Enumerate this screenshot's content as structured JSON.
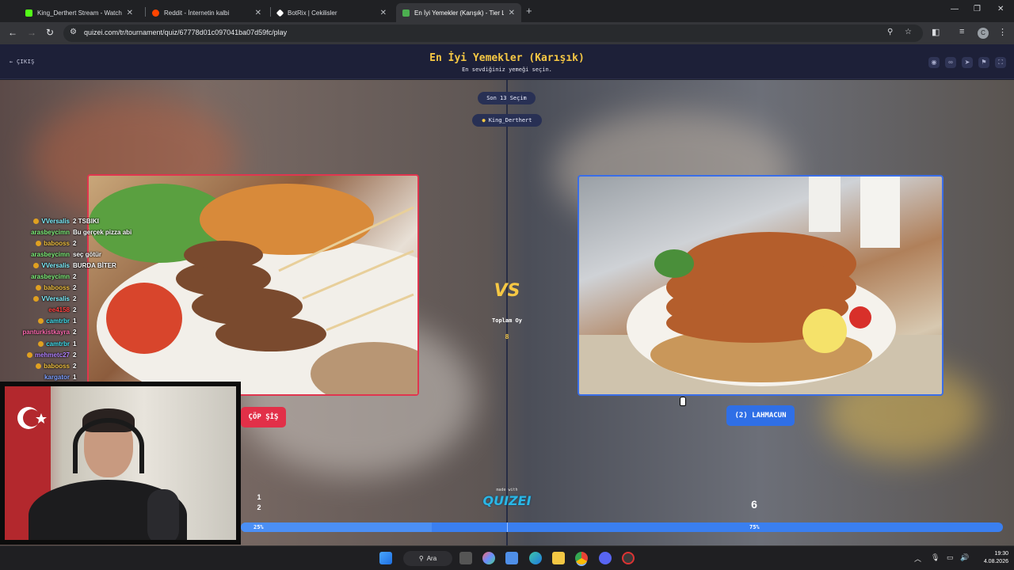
{
  "browser": {
    "tabs": [
      {
        "title": "King_Derthert Stream - Watch L",
        "favicon_color": "#53fc18"
      },
      {
        "title": "Reddit - İnternetin kalbi",
        "favicon_color": "#ff4500"
      },
      {
        "title": "BotRix | Cekilisler",
        "favicon_color": "#ffffff"
      },
      {
        "title": "En İyi Yemekler (Karışık) - Tier L",
        "favicon_color": "#4caf50"
      }
    ],
    "url": "quizei.com/tr/tournament/quiz/67778d01c097041ba07d59fc/play",
    "profile_initial": "C"
  },
  "app": {
    "exit_label": "ÇIKIŞ",
    "title": "En İyi Yemekler (Karışık)",
    "subtitle": "En sevdiğiniz yemeği seçin.",
    "round_label": "Son 13 Seçim",
    "streamer": "King_Derthert"
  },
  "choices": {
    "left": {
      "label": "ÇÖP ŞİŞ",
      "count": "1\n2",
      "percent": "25%"
    },
    "right": {
      "label": "(2) LAHMACUN",
      "count": "6",
      "percent": "75%"
    }
  },
  "center": {
    "vs": "VS",
    "total_label": "Toplam Oy",
    "total_value": "8",
    "made_with": "made with",
    "logo": "QUIZEI"
  },
  "progress": {
    "left_fraction": 0.25,
    "right_fraction": 0.75
  },
  "chat": [
    {
      "name": "VVersalis",
      "msg": "2 TSBIKI",
      "color": "#7ef0ff",
      "badge": true
    },
    {
      "name": "arasbeycimn",
      "msg": "Bu gerçek pizza abi",
      "color": "#7ef07a",
      "badge": false
    },
    {
      "name": "babooss",
      "msg": "2",
      "color": "#f0c040",
      "badge": true
    },
    {
      "name": "arasbeycimn",
      "msg": "seç götür",
      "color": "#7ef07a",
      "badge": false
    },
    {
      "name": "VVersalis",
      "msg": "BURDA BİTER",
      "color": "#7ef0ff",
      "badge": true
    },
    {
      "name": "arasbeycimn",
      "msg": "2",
      "color": "#7ef07a",
      "badge": false
    },
    {
      "name": "babooss",
      "msg": "2",
      "color": "#f0c040",
      "badge": true
    },
    {
      "name": "VVersalis",
      "msg": "2",
      "color": "#7ef0ff",
      "badge": true
    },
    {
      "name": "ee4158",
      "msg": "2",
      "color": "#ff4040",
      "badge": false
    },
    {
      "name": "camtrbr",
      "msg": "1",
      "color": "#40e0f0",
      "badge": true
    },
    {
      "name": "panturkistkayra",
      "msg": "2",
      "color": "#ff6ab0",
      "badge": false
    },
    {
      "name": "camtrbr",
      "msg": "1",
      "color": "#40e0f0",
      "badge": true
    },
    {
      "name": "mehmetc27",
      "msg": "2",
      "color": "#b080ff",
      "badge": true
    },
    {
      "name": "babooss",
      "msg": "2",
      "color": "#f0c040",
      "badge": true
    },
    {
      "name": "kargator",
      "msg": "1",
      "color": "#7ea0ff",
      "badge": false
    }
  ],
  "taskbar": {
    "search_label": "Ara",
    "time": "19:30",
    "date": "4.08.2026"
  }
}
